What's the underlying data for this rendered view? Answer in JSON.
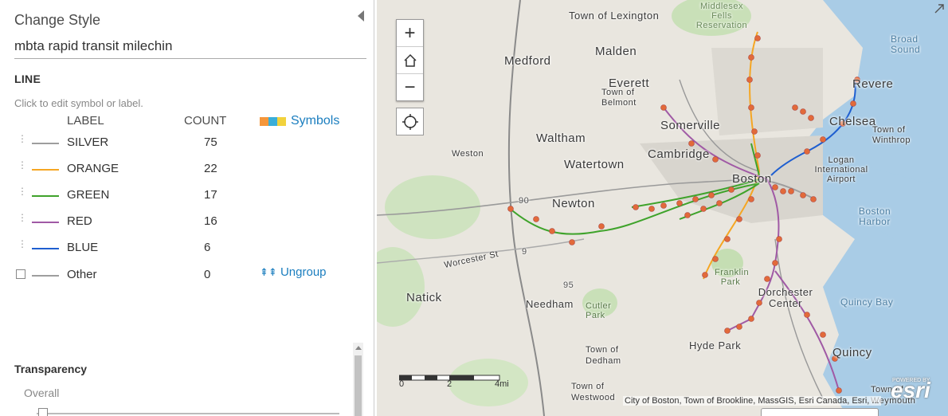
{
  "panel": {
    "title": "Change Style",
    "layer_name": "mbta rapid transit milechin",
    "attribute": "LINE",
    "hint": "Click to edit symbol or label.",
    "columns": {
      "label": "LABEL",
      "count": "COUNT"
    },
    "symbols_link": "Symbols",
    "rows": [
      {
        "label": "SILVER",
        "count": "75",
        "color": "#9e9e9e"
      },
      {
        "label": "ORANGE",
        "count": "22",
        "color": "#f5a623"
      },
      {
        "label": "GREEN",
        "count": "17",
        "color": "#3fa32b"
      },
      {
        "label": "RED",
        "count": "16",
        "color": "#a05aa5"
      },
      {
        "label": "BLUE",
        "count": "6",
        "color": "#1f5fd0"
      }
    ],
    "other": {
      "label": "Other",
      "count": "0",
      "color": "#9e9e9e"
    },
    "ungroup_link": "Ungroup",
    "transparency": {
      "title": "Transparency",
      "overall_label": "Overall"
    }
  },
  "map": {
    "zoom_in": "+",
    "zoom_out": "−",
    "labels": {
      "lexington": "Town of Lexington",
      "medford": "Medford",
      "malden": "Malden",
      "everett": "Everett",
      "revere": "Revere",
      "broad_sound": "Broad Sound",
      "middlesex": "Middlesex Fells Reservation",
      "belmont": "Town of Belmont",
      "somerville": "Somerville",
      "chelsea": "Chelsea",
      "winthrop": "Town of Winthrop",
      "waltham": "Waltham",
      "cambridge": "Cambridge",
      "weston": "Weston",
      "watertown": "Watertown",
      "boston": "Boston",
      "logan": "Logan International Airport",
      "newton": "Newton",
      "boston_harbor": "Boston Harbor",
      "worcester_st": "Worcester St",
      "franklin_park": "Franklin Park",
      "natick": "Natick",
      "needham": "Needham",
      "dorchester": "Dorchester Center",
      "quincy_bay": "Quincy Bay",
      "cutler_park": "Cutler Park",
      "hyde_park": "Hyde Park",
      "quincy": "Quincy",
      "dedham": "Town of Dedham",
      "westwood": "Town of Westwood",
      "weymouth": "Town of Weymouth",
      "route_90": "90",
      "route_95": "95",
      "route_9": "9"
    },
    "scale": {
      "zero": "0",
      "mid": "2",
      "end": "4mi"
    },
    "attribution": "City of Boston, Town of Brookline, MassGIS, Esri Canada, Esri, ...",
    "logo": "esri",
    "powered_by": "POWERED BY"
  }
}
